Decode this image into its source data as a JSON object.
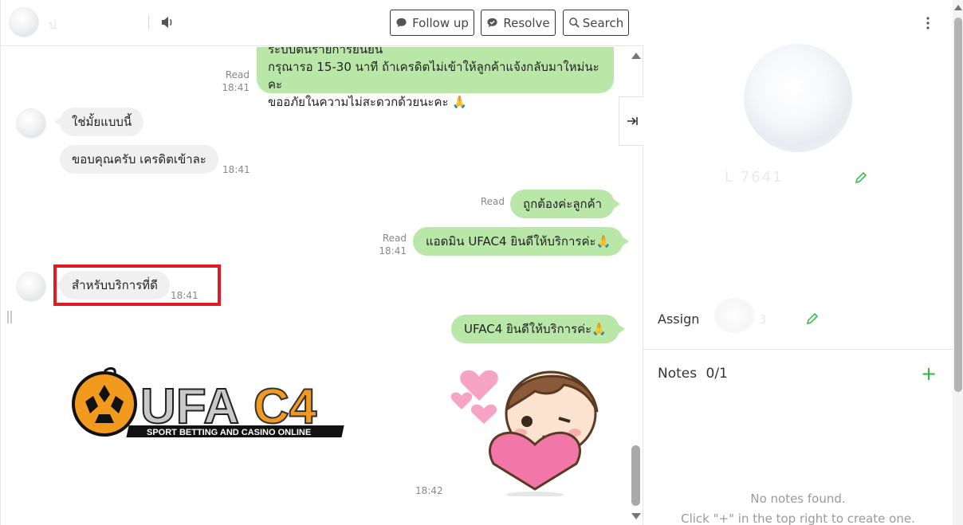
{
  "header": {
    "contact_name": "ป",
    "buttons": {
      "follow_up": "Follow up",
      "resolve": "Resolve",
      "search": "Search"
    }
  },
  "messages": [
    {
      "dir": "out",
      "lines": [
        "ระบบต้นรายการยืนยัน",
        "กรุณารอ 15-30 นาที  ถ้าเครดิตไม่เข้าให้ลูกค้าแจ้งกลับมาใหม่นะคะ",
        "ขออภัยในความไม่สะดวกด้วยนะคะ 🙏"
      ],
      "status": "Read",
      "time": "18:41"
    },
    {
      "dir": "in",
      "text": "ใช่มั้ยแบบนี้"
    },
    {
      "dir": "in",
      "text": "ขอบคุณครับ เครดิตเข้าละ",
      "time": "18:41"
    },
    {
      "dir": "out",
      "text": "ถูกต้องค่ะลูกค้า",
      "status": "Read"
    },
    {
      "dir": "out",
      "text": "แอดมิน UFAC4 ยินดีให้บริการค่ะ🙏",
      "status": "Read",
      "time": "18:41"
    },
    {
      "dir": "in",
      "text": "สำหรับบริการที่ดี",
      "time": "18:41"
    },
    {
      "dir": "out",
      "text": "UFAC4 ยินดีให้บริการค่ะ🙏"
    },
    {
      "dir": "out",
      "type": "sticker",
      "time": "18:42"
    }
  ],
  "logo": {
    "brand": "UFAC4",
    "tagline": "SPORT BETTING AND CASINO ONLINE"
  },
  "side": {
    "profile_name": "L 7641",
    "assign_label": "Assign",
    "assign_name": "3",
    "notes_label": "Notes",
    "notes_count": "0/1",
    "notes_add": "+",
    "empty_line1": "No notes found.",
    "empty_line2": "Click \"+\" in the top right to create one."
  },
  "colors": {
    "accent": "#2db83d",
    "bubble_out": "#b8e7a8",
    "bubble_in": "#f0f0f0",
    "highlight": "#e01b24"
  }
}
